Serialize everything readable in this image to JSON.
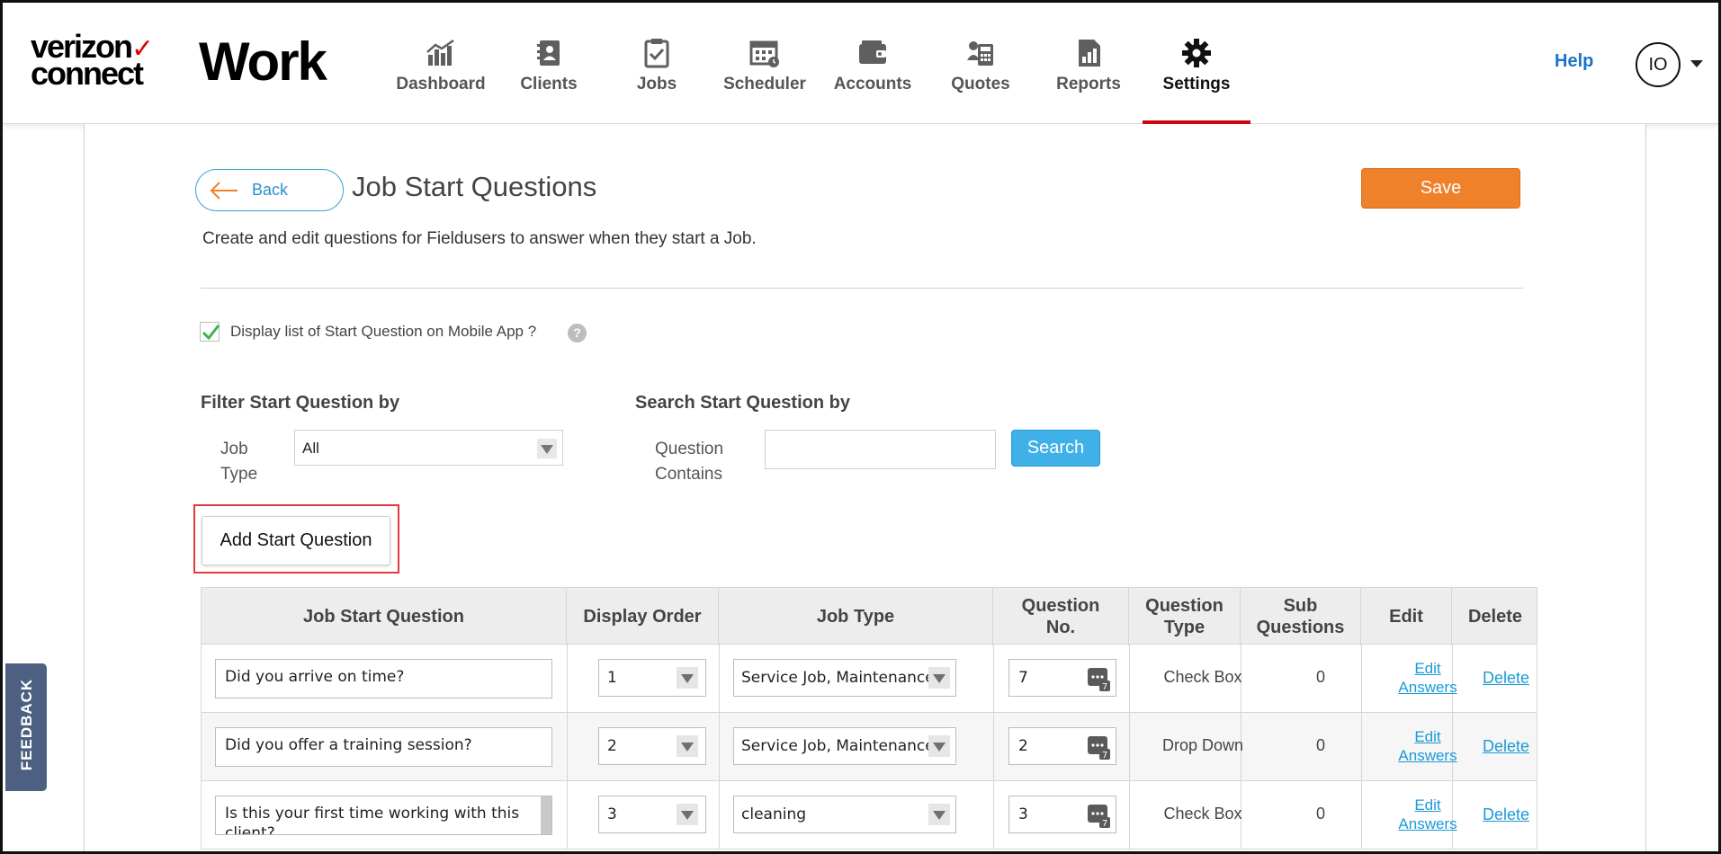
{
  "brand": {
    "logo_line1": "verizon",
    "logo_line2": "connect",
    "product": "Work"
  },
  "nav": [
    {
      "label": "Dashboard",
      "icon": "dashboard-icon"
    },
    {
      "label": "Clients",
      "icon": "clients-icon"
    },
    {
      "label": "Jobs",
      "icon": "jobs-icon"
    },
    {
      "label": "Scheduler",
      "icon": "scheduler-icon"
    },
    {
      "label": "Accounts",
      "icon": "accounts-icon"
    },
    {
      "label": "Quotes",
      "icon": "quotes-icon"
    },
    {
      "label": "Reports",
      "icon": "reports-icon"
    },
    {
      "label": "Settings",
      "icon": "gear-icon",
      "active": true
    }
  ],
  "header": {
    "help": "Help",
    "avatar_initials": "IO"
  },
  "page": {
    "back_label": "Back",
    "title": "Job Start Questions",
    "save_label": "Save",
    "subtitle": "Create and edit questions for Fieldusers to answer when they start a Job.",
    "display_checkbox_label": "Display list of Start Question on Mobile App ?",
    "display_checkbox_checked": true,
    "help_marker": "?"
  },
  "filter": {
    "heading": "Filter Start Question by",
    "job_type_label_line1": "Job",
    "job_type_label_line2": "Type",
    "job_type_value": "All"
  },
  "search": {
    "heading": "Search Start Question by",
    "label_line1": "Question",
    "label_line2": "Contains",
    "value": "",
    "button": "Search"
  },
  "add_button": "Add Start Question",
  "table": {
    "headers": {
      "question": "Job Start Question",
      "display_order": "Display Order",
      "job_type": "Job Type",
      "question_no_1": "Question",
      "question_no_2": "No.",
      "question_type_1": "Question",
      "question_type_2": "Type",
      "sub_questions_1": "Sub",
      "sub_questions_2": "Questions",
      "edit": "Edit",
      "delete": "Delete"
    },
    "rows": [
      {
        "question": "Did you arrive on time?",
        "display_order": "1",
        "job_type": "Service Job, Maintenance Job",
        "question_no": "7",
        "question_type": "Check Box",
        "sub_questions": "0",
        "edit_1": "Edit",
        "edit_2": "Answers",
        "delete": "Delete"
      },
      {
        "question": "Did you offer a training session?",
        "display_order": "2",
        "job_type": "Service Job, Maintenance Job",
        "question_no": "2",
        "question_type": "Drop Down",
        "sub_questions": "0",
        "edit_1": "Edit",
        "edit_2": "Answers",
        "delete": "Delete"
      },
      {
        "question": "Is this your first time working with this client?",
        "display_order": "3",
        "job_type": "cleaning",
        "question_no": "3",
        "question_type": "Check Box",
        "sub_questions": "0",
        "edit_1": "Edit",
        "edit_2": "Answers",
        "delete": "Delete"
      }
    ]
  },
  "feedback_tab": "FEEDBACK",
  "colors": {
    "accent_blue": "#3fb0e8",
    "save_orange": "#f0812b",
    "active_underline": "#cd040b",
    "link_blue": "#1a9ad6",
    "highlight_red": "#e0393e",
    "feedback_bg": "#4d6081"
  }
}
